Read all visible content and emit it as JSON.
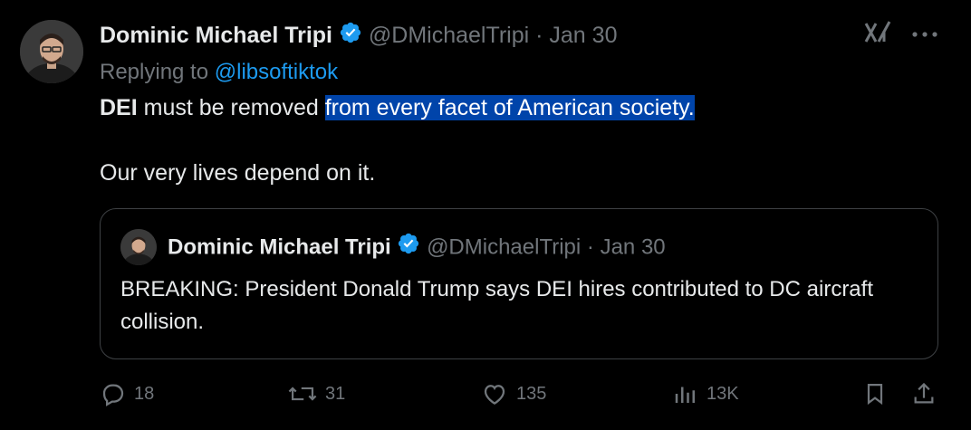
{
  "tweet": {
    "author_name": "Dominic Michael Tripi",
    "handle": "@DMichaelTripi",
    "separator": "·",
    "date": "Jan 30",
    "replying_prefix": "Replying to",
    "replying_to": "@libsoftiktok",
    "text_bold": "DEI",
    "text_plain": " must be removed ",
    "text_highlighted": "from every facet of American society.",
    "text_line2": "Our very lives depend on it."
  },
  "quoted": {
    "author_name": "Dominic Michael Tripi",
    "handle": "@DMichaelTripi",
    "separator": "·",
    "date": "Jan 30",
    "text": "BREAKING: President Donald Trump says DEI hires contributed to DC aircraft collision."
  },
  "actions": {
    "replies": "18",
    "reposts": "31",
    "likes": "135",
    "views": "13K"
  },
  "icons": [
    "grok-icon",
    "more-icon",
    "reply-icon",
    "repost-icon",
    "like-icon",
    "views-icon",
    "bookmark-icon",
    "share-icon",
    "verified-icon"
  ],
  "colors": {
    "background": "#000000",
    "text": "#e7e9ea",
    "muted": "#71767b",
    "accent": "#1d9bf0",
    "highlight": "#0044aa"
  }
}
